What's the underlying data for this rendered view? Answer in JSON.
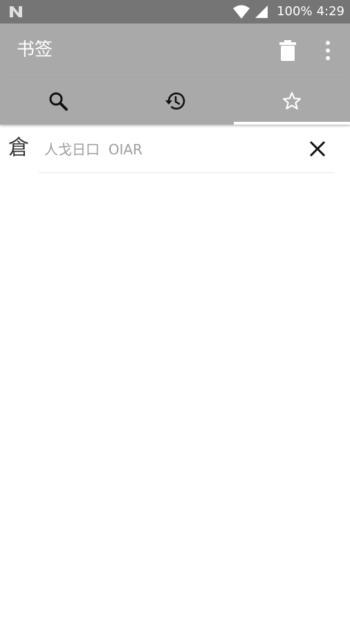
{
  "status_bar": {
    "battery": "100%",
    "time": "4:29",
    "icons": [
      "n-logo-icon",
      "wifi-icon",
      "signal-icon"
    ]
  },
  "app_bar": {
    "title": "书签",
    "actions": [
      "delete-icon",
      "more-vert-icon"
    ]
  },
  "tabs": [
    {
      "icon": "search-icon"
    },
    {
      "icon": "history-icon"
    },
    {
      "icon": "star-outline-icon",
      "selected": true
    }
  ],
  "bookmarks": [
    {
      "character": "倉",
      "code": "人戈日口  OIAR",
      "remove_icon": "close-icon"
    }
  ],
  "colors": {
    "status_bar": "#757575",
    "app_bar": "#a9a9a9",
    "title_text": "#ffffff",
    "code_text": "#9e9e9e",
    "indicator": "#ffffff"
  }
}
